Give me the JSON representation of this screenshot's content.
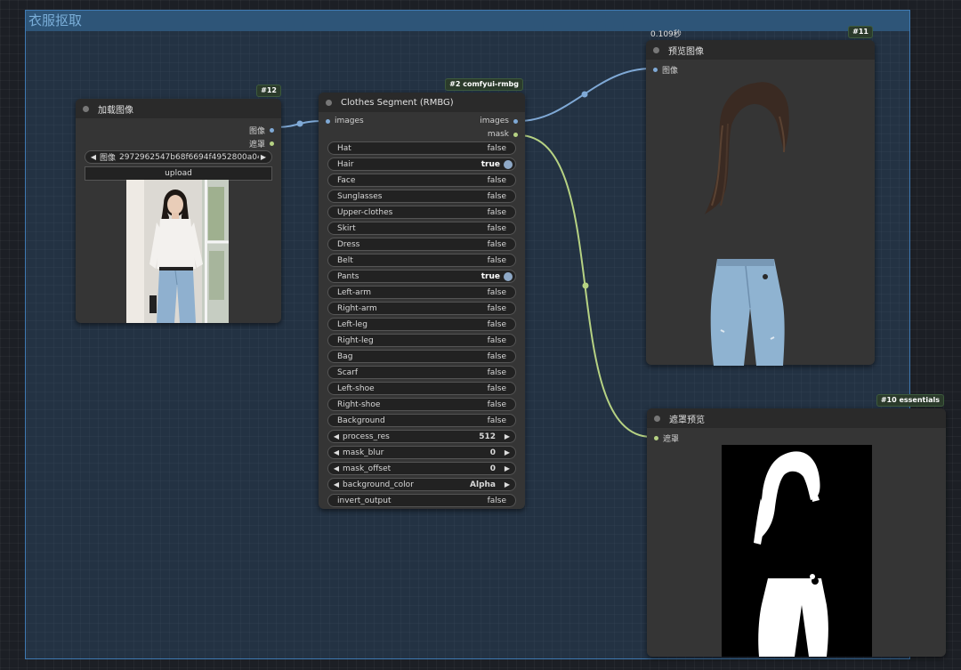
{
  "group": {
    "title": "衣服抠取"
  },
  "colors": {
    "image_wire": "#7fa9d6",
    "mask_wire": "#b6d283",
    "group_border": "#3f7ab3"
  },
  "load_node": {
    "badge": "#12",
    "title": "加载图像",
    "outputs": [
      "图像",
      "遮罩"
    ],
    "image_combo": {
      "label": "图像",
      "value": "2972962547b68f6694f4952800a04..."
    },
    "upload_label": "upload",
    "preview_icon": "woman-photo"
  },
  "seg_node": {
    "badge": "#2 comfyui-rmbg",
    "title": "Clothes Segment (RMBG)",
    "input": "images",
    "outputs": [
      "images",
      "mask"
    ],
    "toggles": [
      {
        "label": "Hat",
        "value": "false"
      },
      {
        "label": "Hair",
        "value": "true"
      },
      {
        "label": "Face",
        "value": "false"
      },
      {
        "label": "Sunglasses",
        "value": "false"
      },
      {
        "label": "Upper-clothes",
        "value": "false"
      },
      {
        "label": "Skirt",
        "value": "false"
      },
      {
        "label": "Dress",
        "value": "false"
      },
      {
        "label": "Belt",
        "value": "false"
      },
      {
        "label": "Pants",
        "value": "true"
      },
      {
        "label": "Left-arm",
        "value": "false"
      },
      {
        "label": "Right-arm",
        "value": "false"
      },
      {
        "label": "Left-leg",
        "value": "false"
      },
      {
        "label": "Right-leg",
        "value": "false"
      },
      {
        "label": "Bag",
        "value": "false"
      },
      {
        "label": "Scarf",
        "value": "false"
      },
      {
        "label": "Left-shoe",
        "value": "false"
      },
      {
        "label": "Right-shoe",
        "value": "false"
      },
      {
        "label": "Background",
        "value": "false"
      }
    ],
    "combos": [
      {
        "label": "process_res",
        "value": "512"
      },
      {
        "label": "mask_blur",
        "value": "0"
      },
      {
        "label": "mask_offset",
        "value": "0"
      },
      {
        "label": "background_color",
        "value": "Alpha"
      }
    ],
    "invert_output": {
      "label": "invert_output",
      "value": "false"
    }
  },
  "preview_node": {
    "timing": "0.109秒",
    "badge": "#11",
    "title": "预览图像",
    "input": "图像",
    "preview_icon": "hair-and-jeans-cutout"
  },
  "mask_node": {
    "badge": "#10 essentials",
    "title": "遮罩预览",
    "input": "遮罩",
    "preview_icon": "silhouette-mask"
  }
}
